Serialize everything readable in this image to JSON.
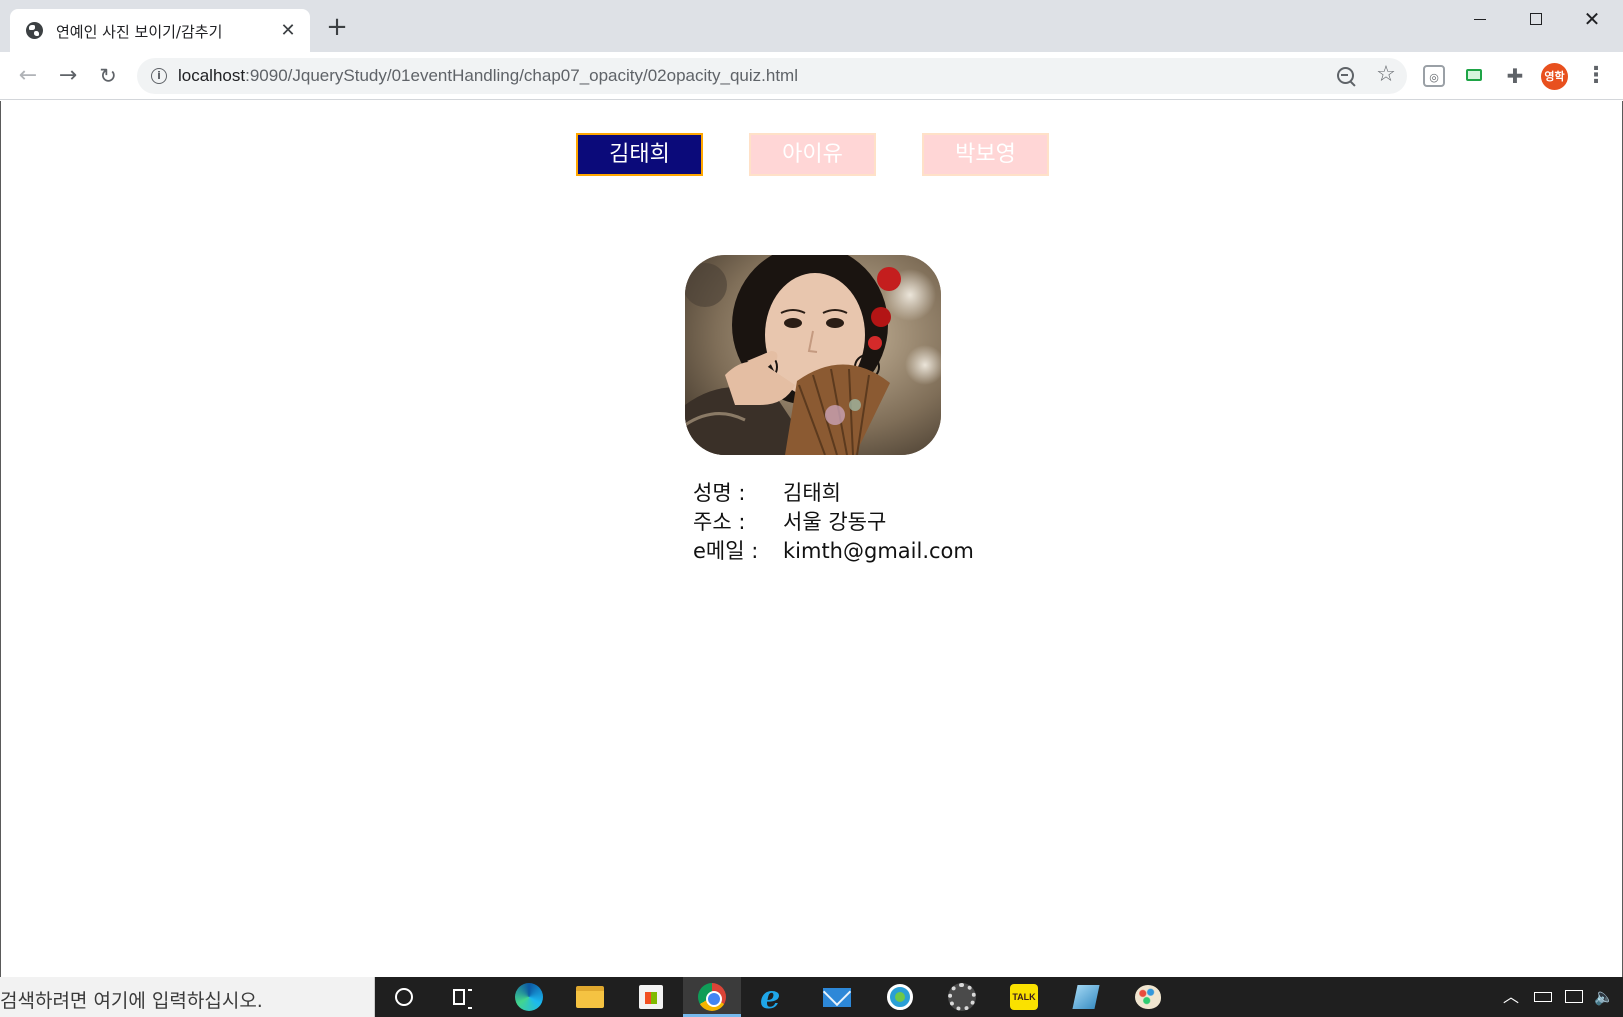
{
  "browser": {
    "tab_title": "연예인 사진 보이기/감추기",
    "tab_close": "✕",
    "new_tab": "+",
    "url_host": "localhost",
    "url_path": ":9090/JqueryStudy/01eventHandling/chap07_opacity/02opacity_quiz.html",
    "profile_initials": "영학"
  },
  "page": {
    "buttons": [
      {
        "label": "김태희",
        "active": true
      },
      {
        "label": "아이유",
        "active": false
      },
      {
        "label": "박보영",
        "active": false
      }
    ],
    "info": {
      "name_label": "성명 :",
      "name_value": "김태희",
      "address_label": "주소 :",
      "address_value": "서울 강동구",
      "email_label": "e메일 :",
      "email_value": "kimth@gmail.com"
    },
    "colors": {
      "active_button_bg": "#0b0a7a",
      "active_button_border": "#ffa700",
      "inactive_button_bg": "#ffd6d6"
    }
  },
  "taskbar": {
    "search_placeholder": "검색하려면 여기에 입력하십시오.",
    "talk_label": "TALK",
    "apps": [
      "cortana-icon",
      "task-view-icon",
      "edge-icon",
      "file-explorer-icon",
      "store-icon",
      "chrome-icon",
      "internet-explorer-icon",
      "mail-icon",
      "camtasia-icon",
      "gear-app-icon",
      "kakaotalk-icon",
      "notepad-icon",
      "paint-icon"
    ]
  }
}
